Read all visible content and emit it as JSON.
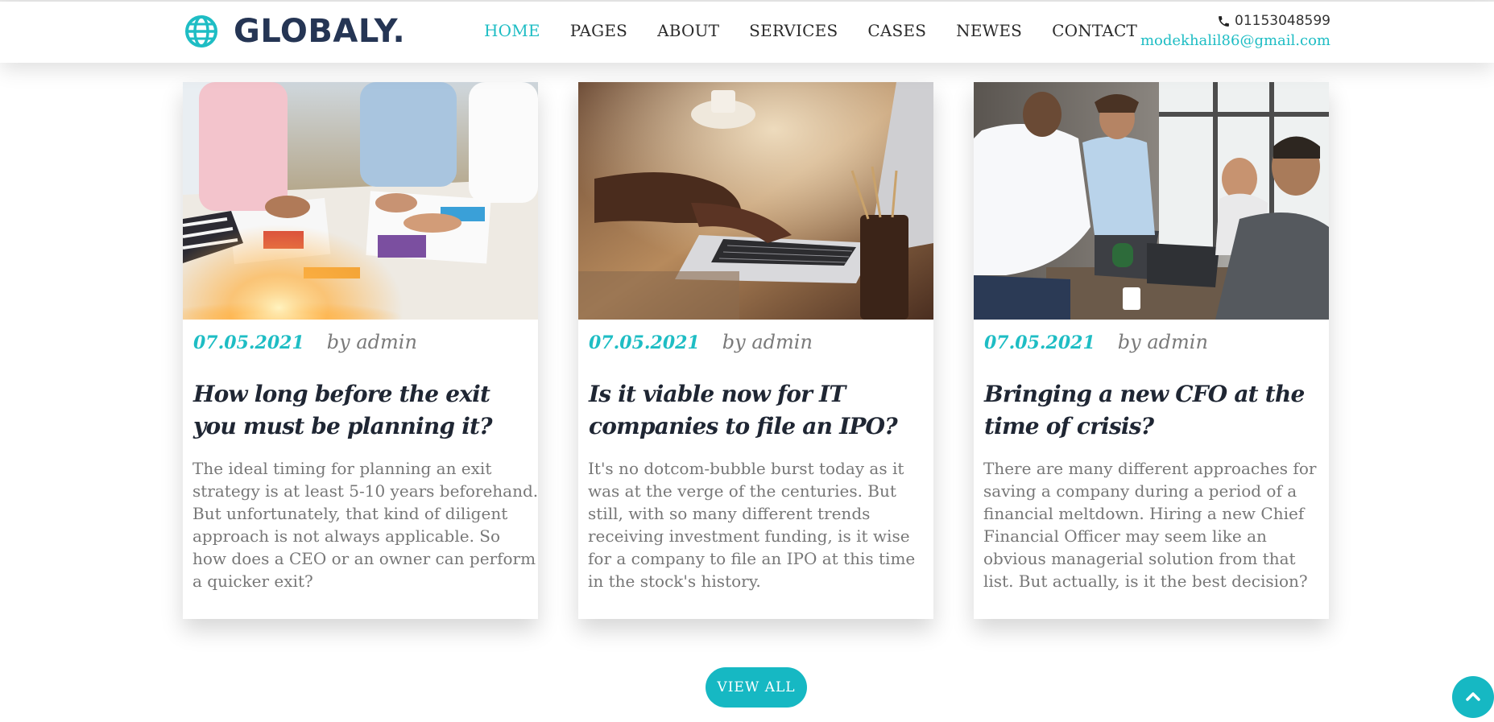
{
  "brand": {
    "name": "GLOBALY.",
    "icon": "globe-icon",
    "accent": "#1ebdc4",
    "dark": "#253554"
  },
  "nav": [
    {
      "label": "HOME",
      "active": true
    },
    {
      "label": "PAGES"
    },
    {
      "label": "ABOUT"
    },
    {
      "label": "SERVICES"
    },
    {
      "label": "CASES"
    },
    {
      "label": "NEWES"
    },
    {
      "label": "CONTACT"
    }
  ],
  "contact": {
    "phone": "01153048599",
    "phone_icon": "phone-icon",
    "email": "modekhalil86@gmail.com"
  },
  "posts": [
    {
      "date": "07.05.2021",
      "author": "by admin",
      "title": "How long before the exit you must be planning it?",
      "text": "The ideal timing for planning an exit strategy is at least 5-10 years beforehand. But unfortunately, that kind of diligent approach is not always applicable. So how does a CEO or an owner can perform a quicker exit?",
      "image": "team-reviewing-charts-photo"
    },
    {
      "date": "07.05.2021",
      "author": "by admin",
      "title": "Is it viable now for IT companies to file an IPO?",
      "text": "It's no dotcom-bubble burst today as it was at the verge of the centuries. But still, with so many different trends receiving investment funding, is it wise for a company to file an IPO at this time in the stock's history.",
      "image": "hands-typing-laptop-photo"
    },
    {
      "date": "07.05.2021",
      "author": "by admin",
      "title": "Bringing a new CFO at the time of crisis?",
      "text": "There are many different approaches for saving a company during a period of a financial meltdown. Hiring a new Chief Financial Officer may seem like an obvious managerial solution from that list. But actually, is it the best decision?",
      "image": "business-handshake-office-photo"
    }
  ],
  "view_all_label": "VIEW ALL",
  "scroll_top_icon": "chevron-up-icon"
}
